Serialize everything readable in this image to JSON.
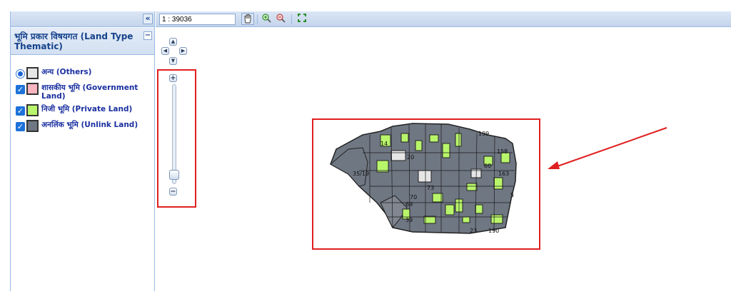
{
  "sidebar": {
    "collapse_label": "«",
    "title": "भूमि प्रकार विषयगत (Land Type Thematic)",
    "minimize_label": "−",
    "legend": [
      {
        "control": "radio",
        "label": "अन्य (Others)",
        "swatch_color": "#e6e6e6"
      },
      {
        "control": "checkbox",
        "label": "शासकीय भूमि (Government Land)",
        "swatch_color": "#f8b4c0"
      },
      {
        "control": "checkbox",
        "label": "निजी भूमि (Private Land)",
        "swatch_color": "#b9f56b"
      },
      {
        "control": "checkbox",
        "label": "अनलिंक भूमि (Unlink Land)",
        "swatch_color": "#6f7783"
      }
    ],
    "checkmark": "✓"
  },
  "toolbar": {
    "scale": "1 : 39036",
    "pan_icon": "hand-icon",
    "zoom_in_icon": "zoom-in-icon",
    "zoom_out_icon": "zoom-out-icon",
    "full_extent_icon": "full-extent-icon"
  },
  "nav": {
    "up": "▲",
    "down": "▼",
    "left": "◀",
    "right": "▶",
    "zoom_in": "+",
    "zoom_out": "−",
    "zoom_level": 0.12
  },
  "map": {
    "parcel_labels": [
      "199",
      "158",
      "163",
      "20",
      "35/19",
      "70",
      "73",
      "69",
      "39",
      "5",
      "14",
      "60",
      "190",
      "23"
    ],
    "colors": {
      "unlink": "#6f7783",
      "private": "#b9f56b",
      "others": "#e6e6e6",
      "highlight": "#e02020"
    }
  }
}
